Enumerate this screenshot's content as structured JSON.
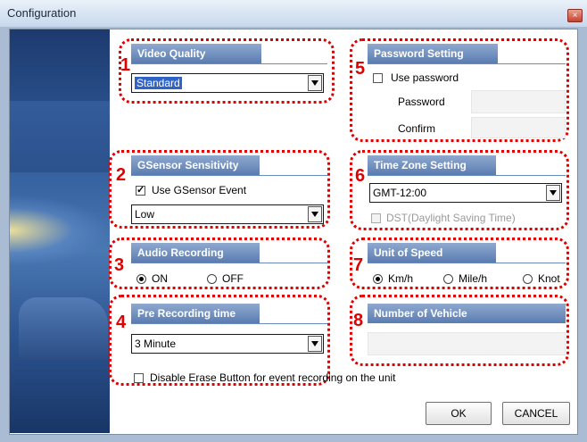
{
  "window": {
    "title": "Configuration",
    "close_glyph": "×"
  },
  "sections": {
    "video_quality": {
      "number": "1",
      "header": "Video Quality",
      "value": "Standard"
    },
    "gsensor": {
      "number": "2",
      "header": "GSensor Sensitivity",
      "checkbox_label": "Use GSensor Event",
      "checked": true,
      "value": "Low"
    },
    "audio": {
      "number": "3",
      "header": "Audio Recording",
      "options": [
        "ON",
        "OFF"
      ],
      "selected": "ON"
    },
    "pre_recording": {
      "number": "4",
      "header": "Pre Recording time",
      "value": "3 Minute"
    },
    "password": {
      "number": "5",
      "header": "Password Setting",
      "checkbox_label": "Use password",
      "checked": false,
      "password_label": "Password",
      "confirm_label": "Confirm"
    },
    "timezone": {
      "number": "6",
      "header": "Time Zone Setting",
      "value": "GMT-12:00",
      "dst_label": "DST(Daylight Saving Time)",
      "dst_enabled": false
    },
    "speed": {
      "number": "7",
      "header": "Unit of Speed",
      "options": [
        "Km/h",
        "Mile/h",
        "Knot"
      ],
      "selected": "Km/h"
    },
    "vehicle": {
      "number": "8",
      "header": "Number of Vehicle",
      "value": ""
    }
  },
  "disable_erase": {
    "label": "Disable Erase Button for event recording on the unit",
    "checked": false
  },
  "buttons": {
    "ok": "OK",
    "cancel": "CANCEL"
  },
  "colors": {
    "annotation": "#e00000",
    "header": "#6a8bbd",
    "selection": "#2f63c8"
  }
}
